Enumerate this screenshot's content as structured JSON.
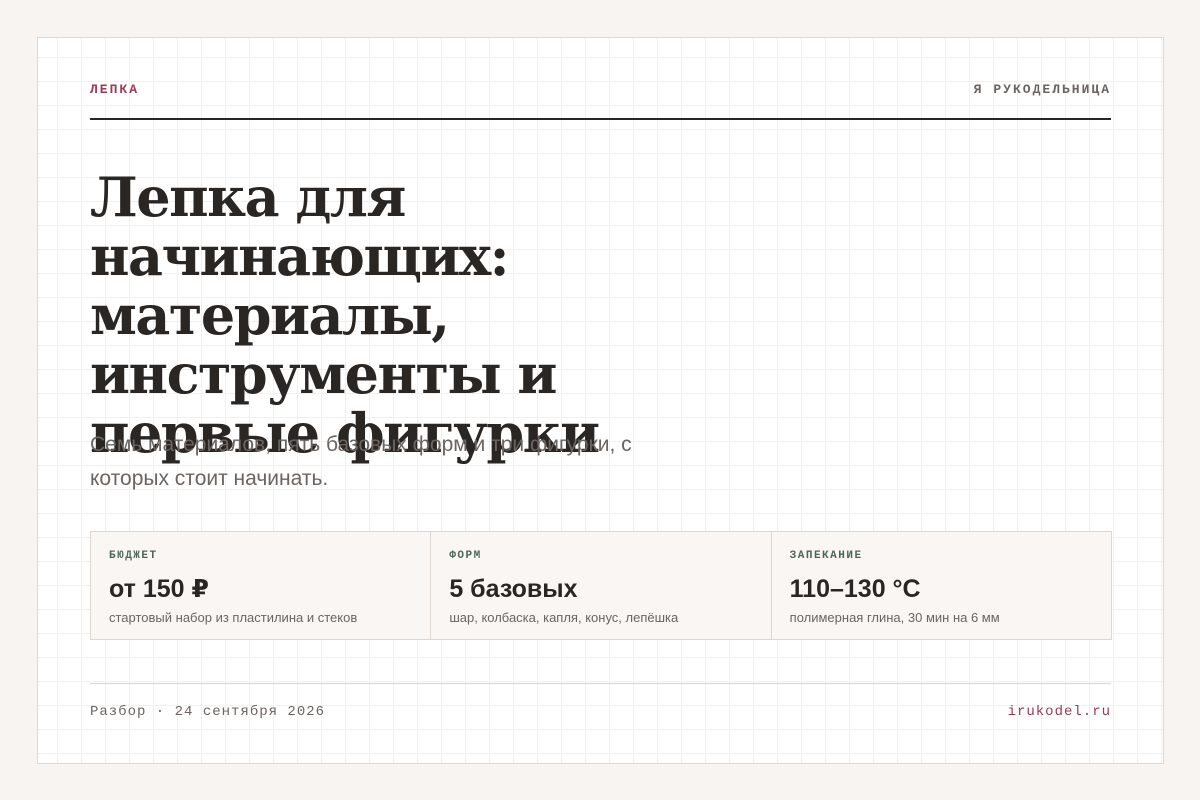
{
  "header": {
    "section_tag": "ЛЕПКА",
    "brand": "Я РУКОДЕЛЬНИЦА"
  },
  "article": {
    "headline_lines": [
      "Лепка для начинающих:",
      "материалы,",
      "инструменты и",
      "первые фигурки"
    ],
    "subtitle_lines": [
      "Семь материалов, пять базовых форм и три фигурки, с",
      "которых стоит начинать."
    ]
  },
  "stats": [
    {
      "label": "БЮДЖЕТ",
      "value": "от 150 ₽",
      "note": "стартовый набор из пластилина и стеков"
    },
    {
      "label": "ФОРМ",
      "value": "5 базовых",
      "note": "шар, колбаска, капля, конус, лепёшка"
    },
    {
      "label": "ЗАПЕКАНИЕ",
      "value": "110–130 °C",
      "note": "полимерная глина, 30 мин на 6 мм"
    }
  ],
  "footer": {
    "date": "Разбор · 24 сентября 2026",
    "site": "irukodel.ru"
  },
  "colors": {
    "accent": "#9b3a52",
    "label_green": "#4f6655",
    "text_dark": "#2a2624",
    "text_muted": "#6b6461",
    "page_background": "#f8f4f1"
  }
}
